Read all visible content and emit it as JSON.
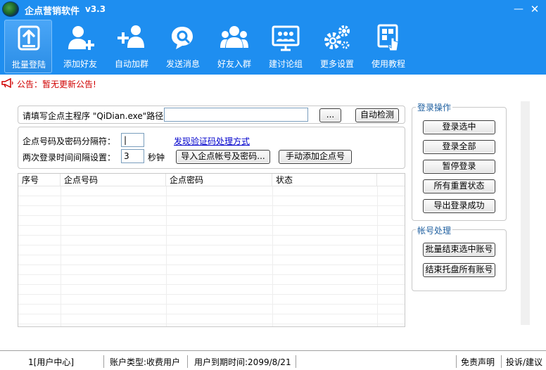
{
  "window": {
    "title": "企点营销软件",
    "version": "v3.3",
    "minimize_glyph": "—",
    "close_glyph": "✕"
  },
  "toolbar": {
    "items": [
      {
        "label": "批量登陆",
        "icon": "upload-box-icon",
        "active": true
      },
      {
        "label": "添加好友",
        "icon": "add-user-icon",
        "active": false
      },
      {
        "label": "自动加群",
        "icon": "add-group-icon",
        "active": false
      },
      {
        "label": "发送消息",
        "icon": "message-search-icon",
        "active": false
      },
      {
        "label": "好友入群",
        "icon": "group-users-icon",
        "active": false
      },
      {
        "label": "建讨论组",
        "icon": "discussion-board-icon",
        "active": false
      },
      {
        "label": "更多设置",
        "icon": "gears-icon",
        "active": false
      },
      {
        "label": "使用教程",
        "icon": "tutorial-touch-icon",
        "active": false
      }
    ]
  },
  "notice": {
    "text": "公告：暂无更新公告!",
    "icon": "megaphone-icon",
    "color": "#d00000"
  },
  "login_settings": {
    "path_label": "请填写企点主程序 \"QiDian.exe\"路径：",
    "path_value": "",
    "browse_label": "...",
    "auto_detect_label": "自动检测",
    "separator_label": "企点号码及密码分隔符：",
    "separator_value": "|",
    "captcha_link": "发现验证码处理方式",
    "interval_label": "两次登录时间间隔设置：",
    "interval_value": "3",
    "interval_unit": "秒钟",
    "import_label": "导入企点帐号及密码...",
    "manual_add_label": "手动添加企点号"
  },
  "table": {
    "columns": [
      "序号",
      "企点号码",
      "企点密码",
      "状态"
    ],
    "rows": []
  },
  "login_ops": {
    "title": "登录操作",
    "buttons": [
      "登录选中",
      "登录全部",
      "暂停登录",
      "所有重置状态",
      "导出登录成功"
    ]
  },
  "account_ops": {
    "title": "帐号处理",
    "buttons": [
      "批量结束选中账号",
      "结束托盘所有账号"
    ]
  },
  "statusbar": {
    "user_center": "1[用户中心]",
    "account_type": "账户类型:收费用户",
    "expiry": "用户到期时间:2099/8/21",
    "disclaimer": "免责声明",
    "feedback": "投诉/建议"
  },
  "colors": {
    "header_blue": "#1e8ef0",
    "notice_red": "#d00000",
    "legend_blue": "#2060a0"
  }
}
